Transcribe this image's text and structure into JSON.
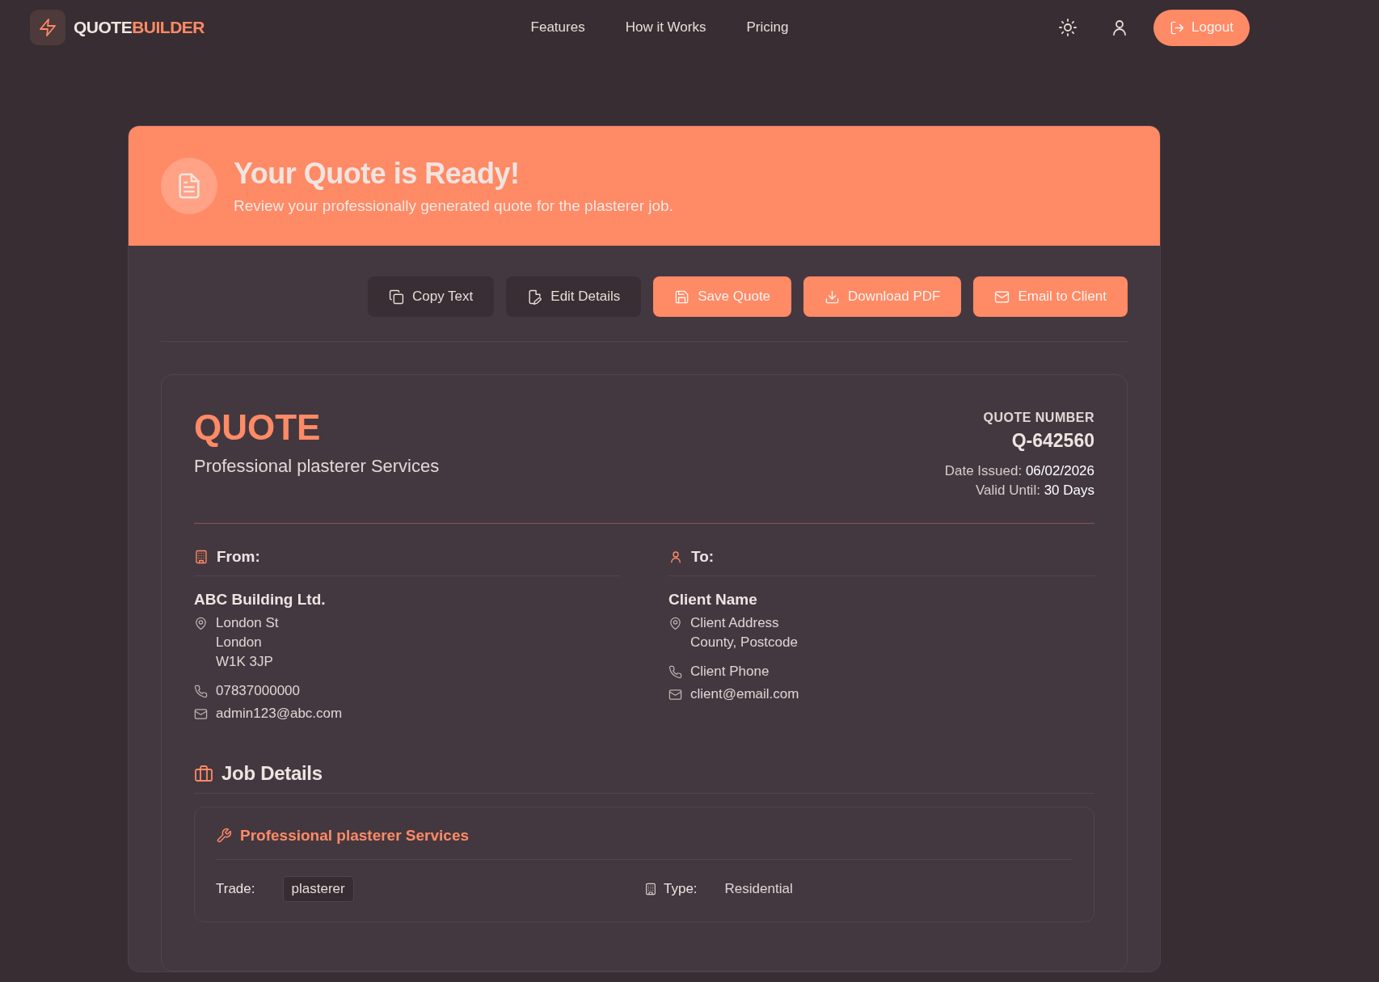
{
  "nav": {
    "brand": {
      "first": "QUOTE",
      "second": "BUILDER"
    },
    "links": [
      "Features",
      "How it Works",
      "Pricing"
    ],
    "logout": "Logout"
  },
  "banner": {
    "title": "Your Quote is Ready!",
    "subtitle": "Review your professionally generated quote for the plasterer job."
  },
  "actions": [
    {
      "label": "Copy Text",
      "kind": "secondary"
    },
    {
      "label": "Edit Details",
      "kind": "secondary"
    },
    {
      "label": "Save Quote",
      "kind": "primary"
    },
    {
      "label": "Download PDF",
      "kind": "primary"
    },
    {
      "label": "Email to Client",
      "kind": "primary"
    }
  ],
  "quote": {
    "heading": "QUOTE",
    "subtitle": "Professional plasterer Services",
    "number_label": "QUOTE NUMBER",
    "number": "Q-642560",
    "date_issued": "Date Issued: **06/02/2026**",
    "valid_until": "Valid Until: **30 Days**"
  },
  "from": {
    "heading": "From:",
    "name": "ABC Building Ltd.",
    "address": [
      "London St",
      "London",
      "W1K 3JP"
    ],
    "phone": "07837000000",
    "email": "admin123@abc.com"
  },
  "to": {
    "heading": "To:",
    "name": "Client Name",
    "address": [
      "Client Address",
      "County, Postcode"
    ],
    "phone": "Client Phone",
    "email": "client@email.com"
  },
  "job_details": {
    "heading": "Job Details",
    "service": "Professional plasterer Services",
    "fields": [
      {
        "label": "Trade:",
        "value": "plasterer",
        "kind": "chip"
      },
      {
        "label": "Type:",
        "value": "Residential",
        "kind": "plain"
      }
    ]
  }
}
